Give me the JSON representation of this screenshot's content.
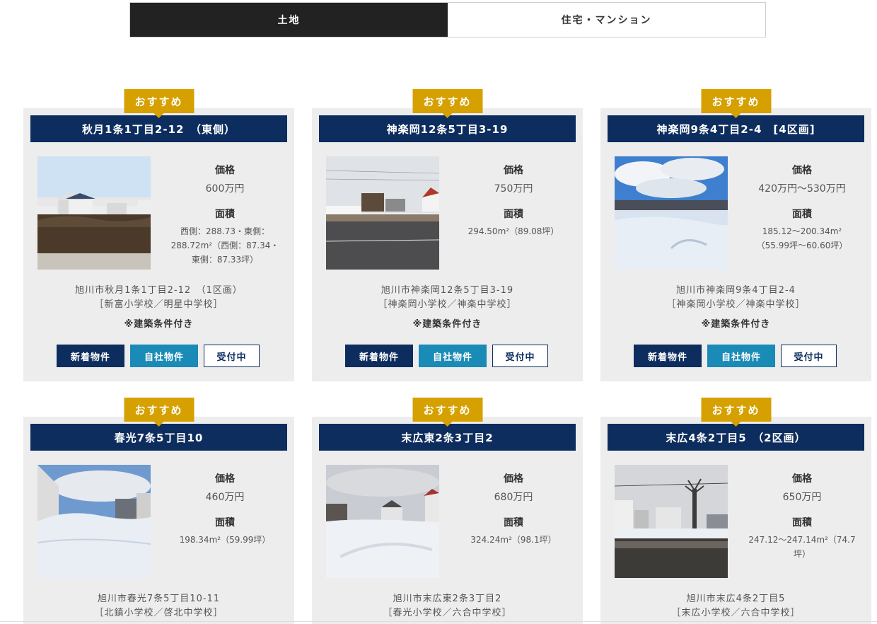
{
  "tabs": [
    {
      "label": "土地",
      "active": true
    },
    {
      "label": "住宅・マンション",
      "active": false
    }
  ],
  "labels": {
    "badge": "おすすめ",
    "price": "価格",
    "area": "面積",
    "new": "新着物件",
    "own": "自社物件",
    "open": "受付中"
  },
  "colors": {
    "navy": "#0d2d5e",
    "gold": "#d5a000",
    "teal": "#1a8ab6",
    "tab_active": "#222222"
  },
  "cards": [
    {
      "title": "秋月1条1丁目2-12　（東側）",
      "price": "600万円",
      "area": "西側：288.73・東側：288.72m²（西側：87.34・東側：87.33坪）",
      "address1": "旭川市秋月1条1丁目2-12　（1区画）",
      "address2": "［新富小学校／明星中学校］",
      "note": "※建築条件付き"
    },
    {
      "title": "神楽岡12条5丁目3-19",
      "price": "750万円",
      "area": "294.50m²（89.08坪）",
      "address1": "旭川市神楽岡12条5丁目3-19",
      "address2": "［神楽岡小学校／神楽中学校］",
      "note": "※建築条件付き"
    },
    {
      "title": "神楽岡9条4丁目2-4　[4区画]",
      "price": "420万円～530万円",
      "area": "185.12～200.34m²（55.99坪～60.60坪）",
      "address1": "旭川市神楽岡9条4丁目2-4",
      "address2": "［神楽岡小学校／神楽中学校］",
      "note": "※建築条件付き"
    },
    {
      "title": "春光7条5丁目10",
      "price": "460万円",
      "area": "198.34m²（59.99坪）",
      "address1": "旭川市春光7条5丁目10-11",
      "address2": "［北鎮小学校／啓北中学校］"
    },
    {
      "title": "末広東2条3丁目2",
      "price": "680万円",
      "area": "324.24m²（98.1坪）",
      "address1": "旭川市末広東2条3丁目2",
      "address2": "［春光小学校／六合中学校］"
    },
    {
      "title": "末広4条2丁目5　（2区画）",
      "price": "650万円",
      "area": "247.12～247.14m²（74.7坪）",
      "address1": "旭川市末広4条2丁目5",
      "address2": "［末広小学校／六合中学校］"
    }
  ]
}
